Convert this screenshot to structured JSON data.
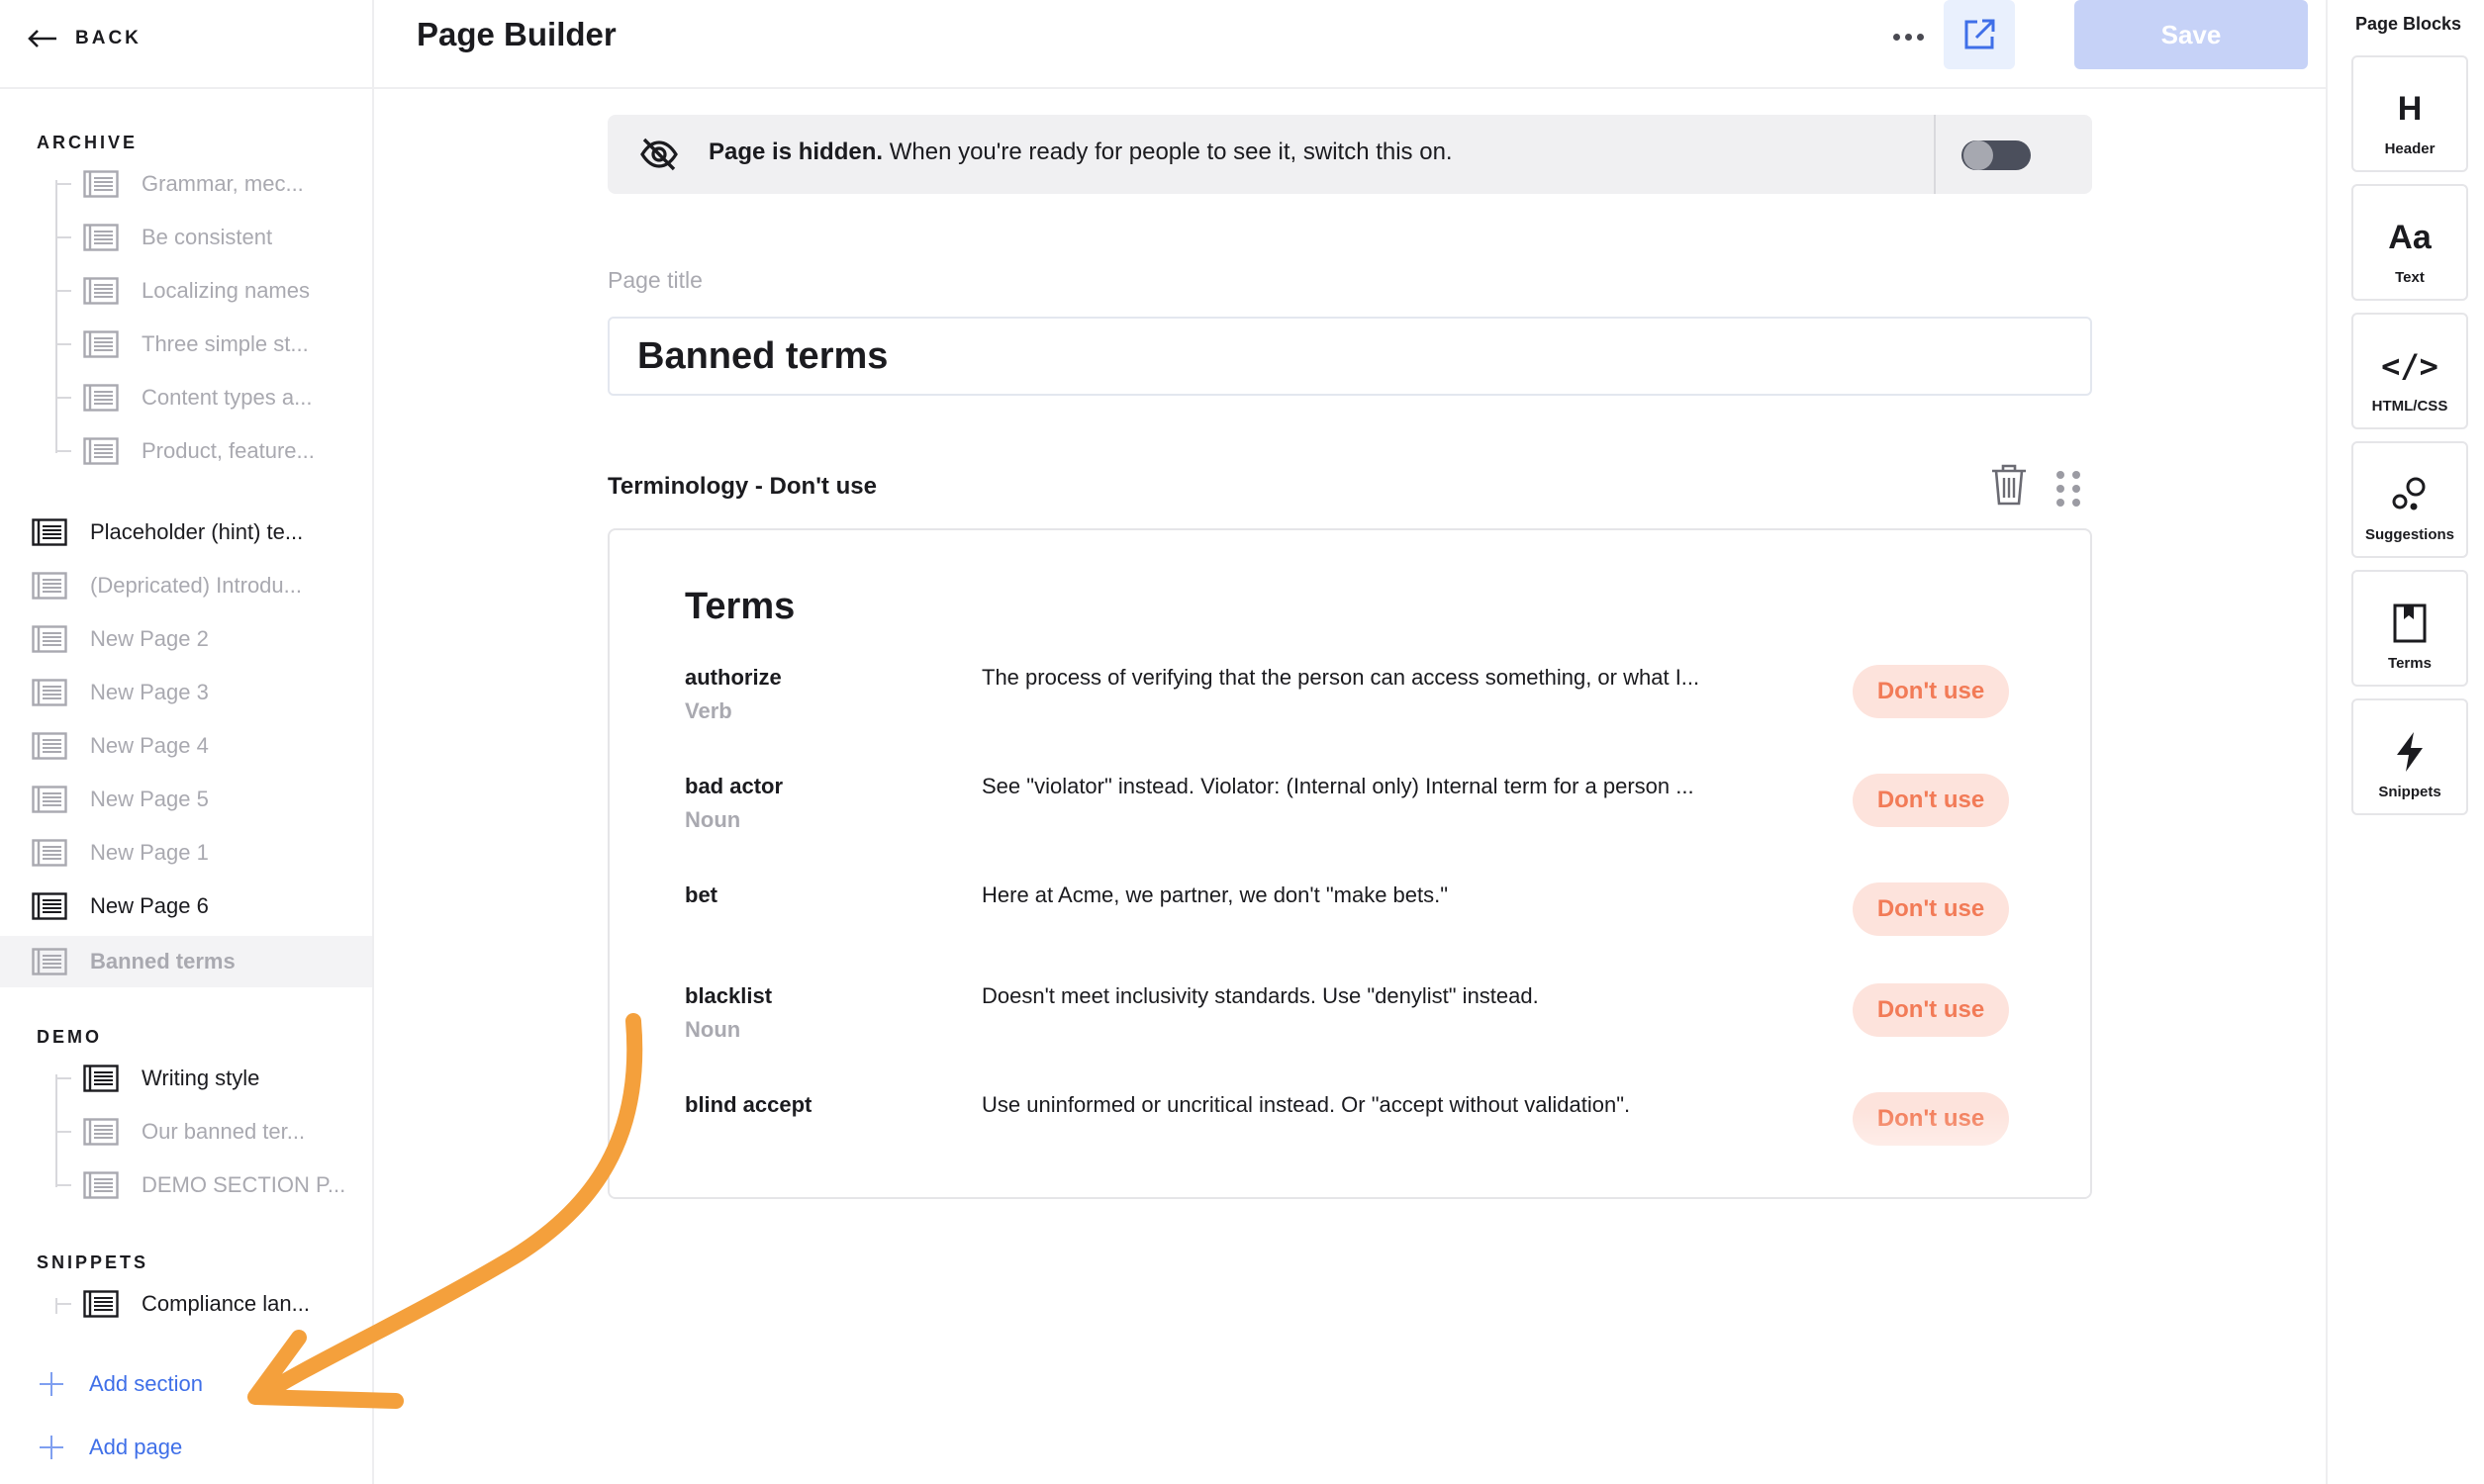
{
  "sidebar": {
    "back_label": "BACK",
    "archive": {
      "heading": "ARCHIVE",
      "items": [
        {
          "label": "Grammar, mec..."
        },
        {
          "label": "Be consistent"
        },
        {
          "label": "Localizing names"
        },
        {
          "label": "Three simple st..."
        },
        {
          "label": "Content types a..."
        },
        {
          "label": "Product, feature..."
        }
      ]
    },
    "pages": [
      {
        "label": "Placeholder (hint) te..."
      },
      {
        "label": "(Depricated) Introdu..."
      },
      {
        "label": "New Page 2"
      },
      {
        "label": "New Page 3"
      },
      {
        "label": "New Page 4"
      },
      {
        "label": "New Page 5"
      },
      {
        "label": "New Page 1"
      },
      {
        "label": "New Page 6"
      },
      {
        "label": "Banned terms"
      }
    ],
    "demo": {
      "heading": "DEMO",
      "items": [
        {
          "label": "Writing style"
        },
        {
          "label": "Our banned ter..."
        },
        {
          "label": "DEMO SECTION P..."
        }
      ]
    },
    "snippets": {
      "heading": "SNIPPETS",
      "items": [
        {
          "label": "Compliance lan..."
        }
      ]
    },
    "add_section_label": "Add section",
    "add_page_label": "Add page"
  },
  "header": {
    "title": "Page Builder",
    "more_icon": "more-horizontal-icon",
    "open_icon": "external-link-icon",
    "save_label": "Save"
  },
  "visibility": {
    "bold": "Page is hidden.",
    "message": " When you're ready for people to see it, switch this on.",
    "toggle_on": false
  },
  "page_title": {
    "label": "Page title",
    "value": "Banned terms"
  },
  "block": {
    "title": "Terminology - Don't use",
    "heading": "Terms",
    "rows": [
      {
        "term": "authorize",
        "pos": "Verb",
        "desc": "The process of verifying that the person can access something, or what I...",
        "badge": "Don't use"
      },
      {
        "term": "bad actor",
        "pos": "Noun",
        "desc": "See \"violator\" instead. Violator: (Internal only) Internal term for a person ...",
        "badge": "Don't use"
      },
      {
        "term": "bet",
        "pos": "",
        "desc": "Here at Acme, we partner, we don't \"make bets.\"",
        "badge": "Don't use"
      },
      {
        "term": "blacklist",
        "pos": "Noun",
        "desc": "Doesn't meet inclusivity standards. Use \"denylist\" instead.",
        "badge": "Don't use"
      },
      {
        "term": "blind accept",
        "pos": "",
        "desc": "Use uninformed or uncritical instead. Or \"accept without validation\".",
        "badge": "Don't use"
      }
    ]
  },
  "page_blocks": {
    "title": "Page Blocks",
    "items": [
      {
        "glyph": "H",
        "label": "Header"
      },
      {
        "glyph": "Aa",
        "label": "Text"
      },
      {
        "glyph": "</>",
        "label": "HTML/CSS"
      },
      {
        "glyph": "",
        "label": "Suggestions"
      },
      {
        "glyph": "",
        "label": "Terms"
      },
      {
        "glyph": "",
        "label": "Snippets"
      }
    ]
  },
  "colors": {
    "accent": "#3f6fe8",
    "save_disabled": "#c6d2f7",
    "badge_bg": "#fde3dc",
    "badge_text": "#f27b57",
    "annotation_arrow": "#f4a03c"
  }
}
